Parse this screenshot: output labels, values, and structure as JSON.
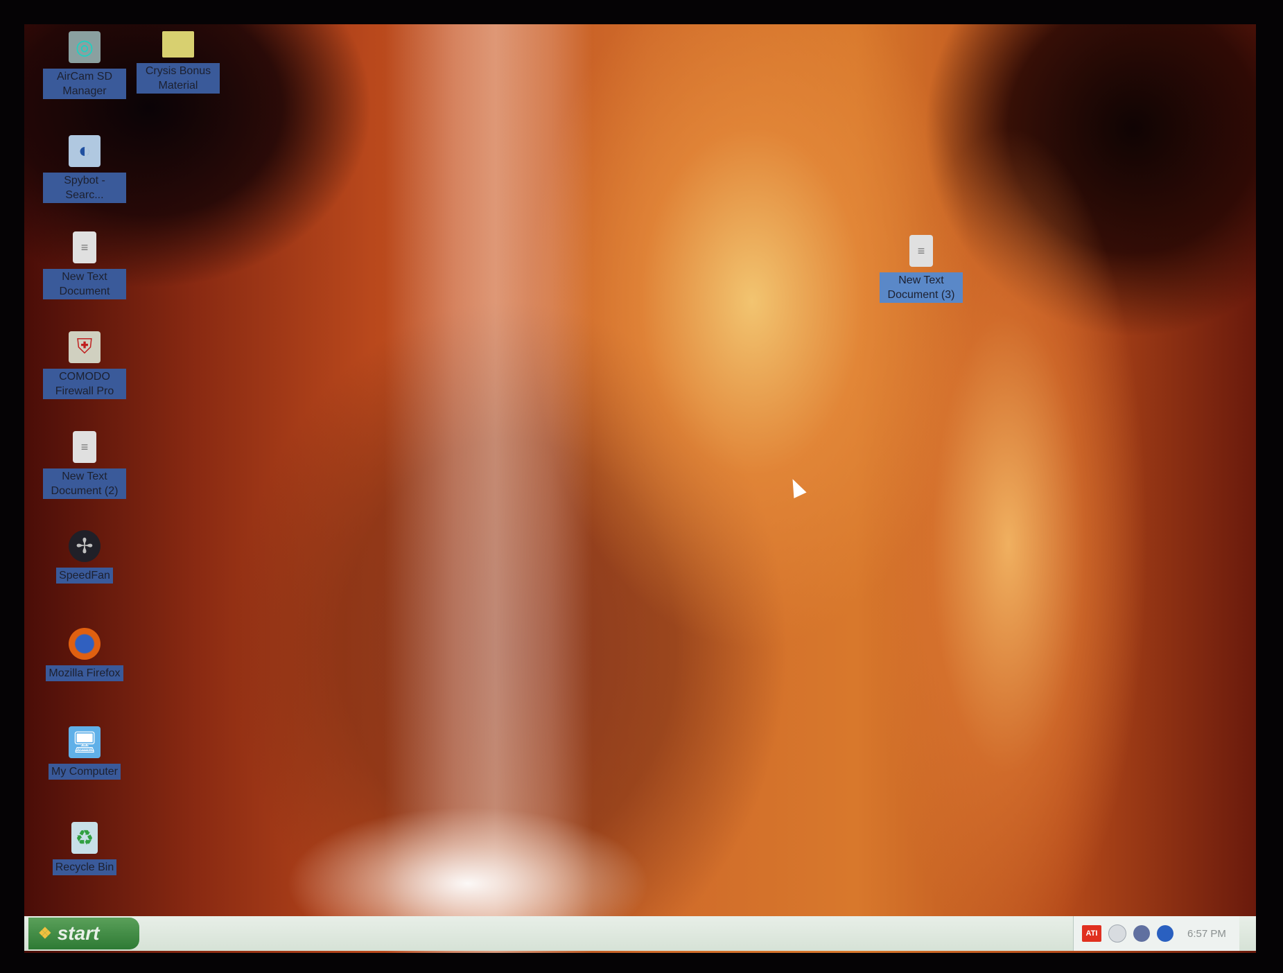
{
  "desktop_icons": [
    {
      "label": "AirCam SD Manager",
      "icon": "camera-icon"
    },
    {
      "label": "Crysis Bonus Material",
      "icon": "folder-icon"
    },
    {
      "label": "Spybot - Searc...",
      "icon": "spybot-icon"
    },
    {
      "label": "New Text Document",
      "icon": "text-document-icon"
    },
    {
      "label": "COMODO Firewall Pro",
      "icon": "shield-icon"
    },
    {
      "label": "New Text Document (2)",
      "icon": "text-document-icon"
    },
    {
      "label": "SpeedFan",
      "icon": "fan-icon"
    },
    {
      "label": "Mozilla Firefox",
      "icon": "firefox-icon"
    },
    {
      "label": "My Computer",
      "icon": "computer-icon"
    },
    {
      "label": "Recycle Bin",
      "icon": "recycle-bin-icon"
    },
    {
      "label": "New Text Document (3)",
      "icon": "text-document-icon"
    }
  ],
  "taskbar": {
    "start_label": "start",
    "tray_ati": "ATI",
    "clock": "6:57 PM"
  }
}
